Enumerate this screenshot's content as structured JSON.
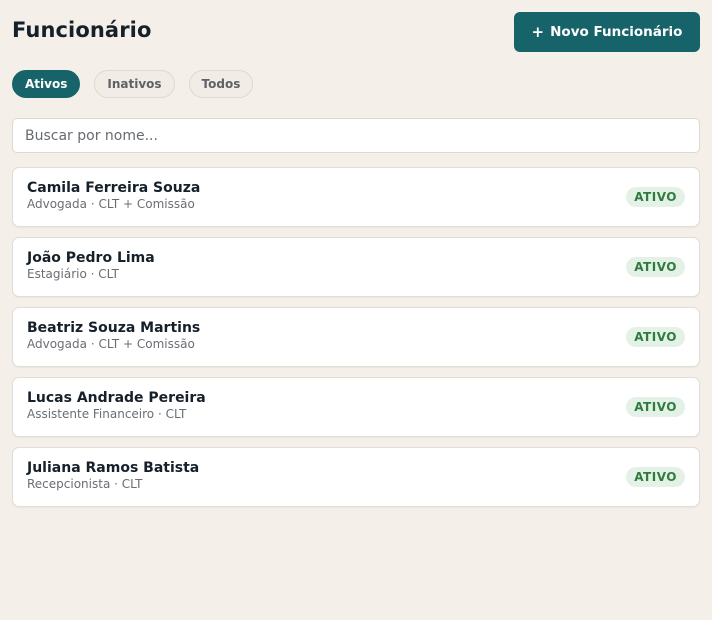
{
  "header": {
    "title": "Funcionário",
    "new_button_label": "Novo Funcionário",
    "new_button_icon": "plus-icon"
  },
  "tabs": [
    {
      "label": "Ativos",
      "active": true
    },
    {
      "label": "Inativos",
      "active": false
    },
    {
      "label": "Todos",
      "active": false
    }
  ],
  "search": {
    "placeholder": "Buscar por nome...",
    "value": ""
  },
  "colors": {
    "accent": "#17636a",
    "background": "#f4efe8",
    "status_active_bg": "#e4f1e6",
    "status_active_text": "#2f7d3d"
  },
  "employees": [
    {
      "name": "Camila Ferreira Souza",
      "meta": "Advogada · CLT + Comissão",
      "status": "ATIVO"
    },
    {
      "name": "João Pedro Lima",
      "meta": "Estagiário · CLT",
      "status": "ATIVO"
    },
    {
      "name": "Beatriz Souza Martins",
      "meta": "Advogada · CLT + Comissão",
      "status": "ATIVO"
    },
    {
      "name": "Lucas Andrade Pereira",
      "meta": "Assistente Financeiro · CLT",
      "status": "ATIVO"
    },
    {
      "name": "Juliana Ramos Batista",
      "meta": "Recepcionista · CLT",
      "status": "ATIVO"
    }
  ]
}
